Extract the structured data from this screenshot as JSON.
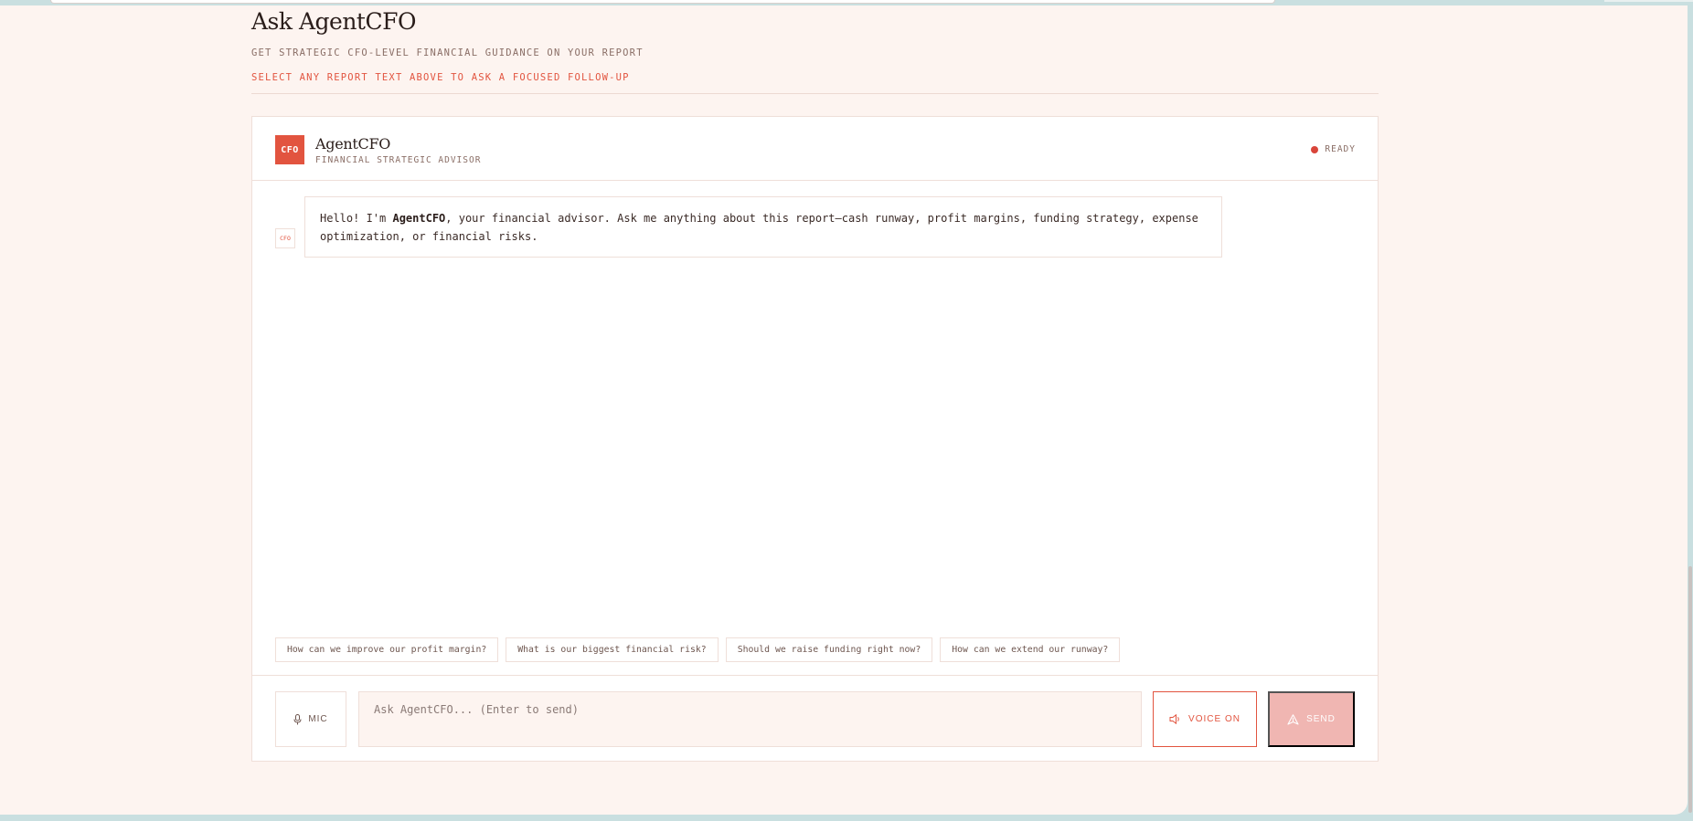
{
  "header": {
    "title": "Ask AgentCFO",
    "subtitle": "GET STRATEGIC CFO-LEVEL FINANCIAL GUIDANCE ON YOUR REPORT",
    "hint": "SELECT ANY REPORT TEXT ABOVE TO ASK A FOCUSED FOLLOW-UP"
  },
  "agent": {
    "logo_text": "CFO",
    "name": "AgentCFO",
    "role": "FINANCIAL STRATEGIC ADVISOR",
    "status": "READY",
    "status_color": "#d9453a"
  },
  "messages": [
    {
      "avatar": "CFO",
      "text_before": "Hello! I'm ",
      "text_bold": "AgentCFO",
      "text_after": ", your financial advisor. Ask me anything about this report—cash runway, profit margins, funding strategy, expense optimization, or financial risks."
    }
  ],
  "suggestions": [
    "How can we improve our profit margin?",
    "What is our biggest financial risk?",
    "Should we raise funding right now?",
    "How can we extend our runway?"
  ],
  "composer": {
    "mic_label": "MIC",
    "mic_icon": "mic-icon",
    "input_placeholder": "Ask AgentCFO... (Enter to send)",
    "voice_label": "VOICE ON",
    "voice_icon": "speaker-icon",
    "send_label": "SEND",
    "send_icon": "send-icon"
  },
  "colors": {
    "accent": "#e2543f",
    "page_bg": "#fdf4f0",
    "send_disabled": "#f0b6b2"
  }
}
